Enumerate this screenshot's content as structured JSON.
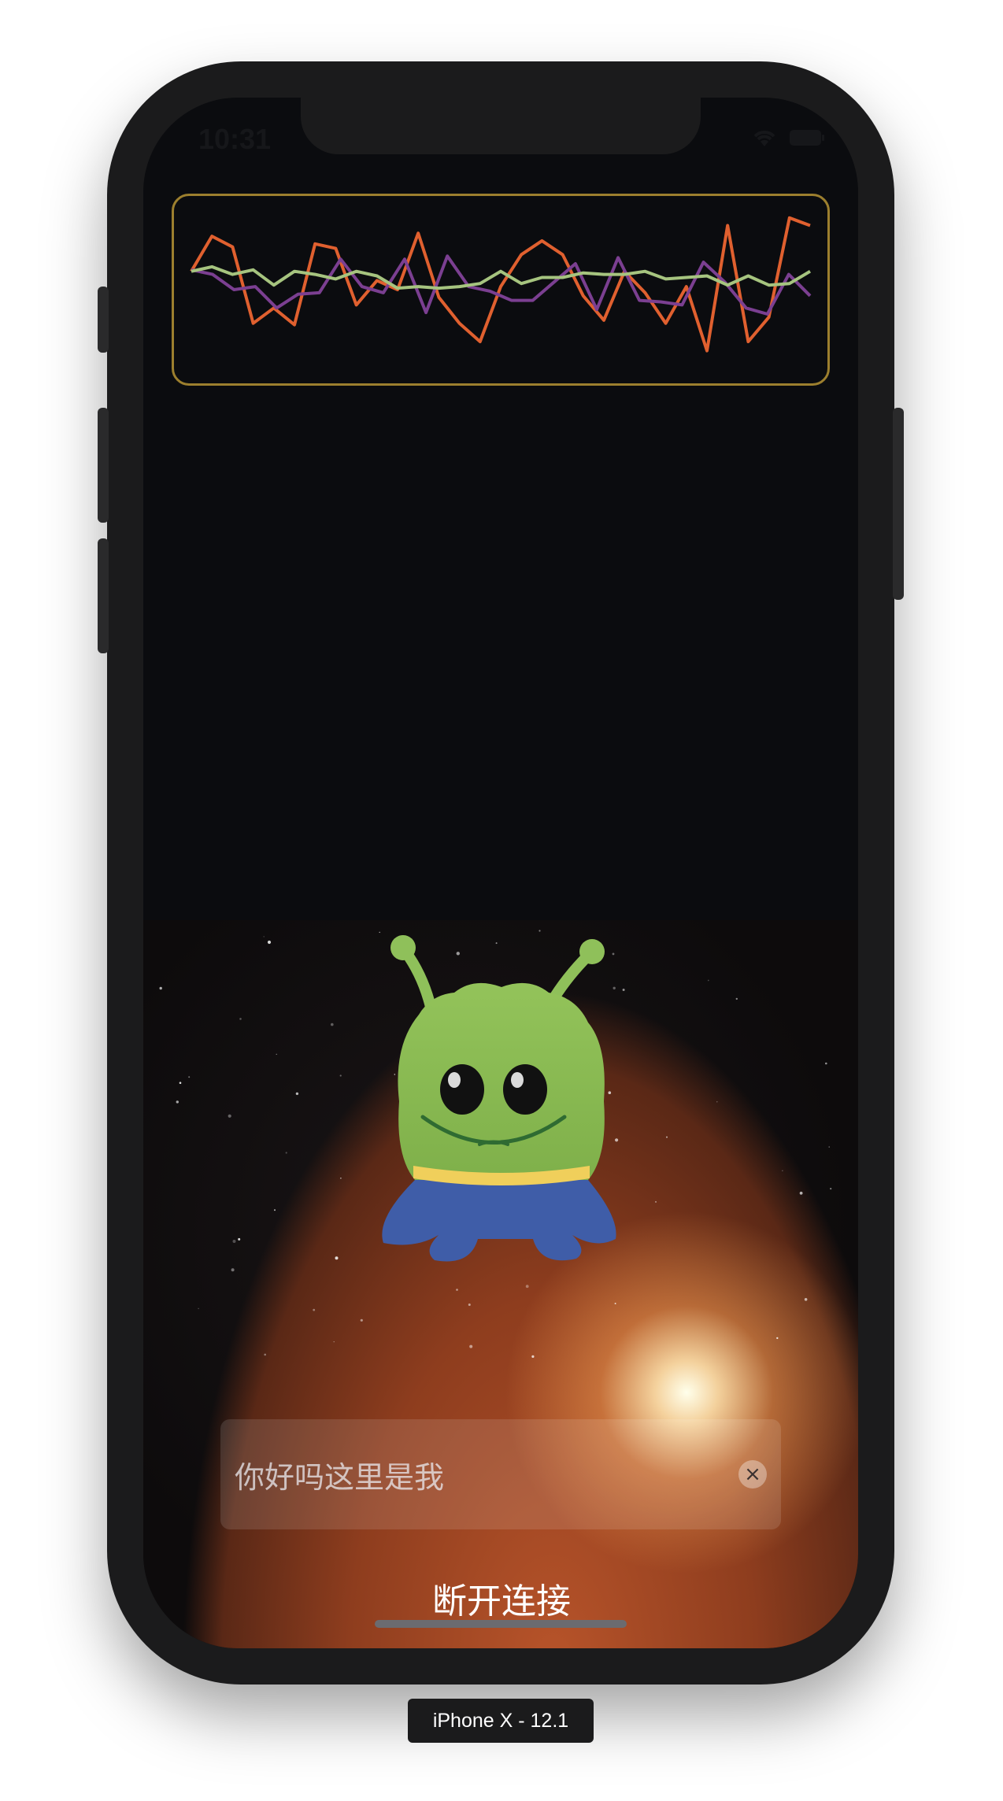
{
  "status_bar": {
    "time": "10:31",
    "icons": [
      "wifi-icon",
      "battery-icon"
    ]
  },
  "chart_data": {
    "type": "line",
    "series": [
      {
        "color": "#e0602f",
        "values": [
          0.62,
          0.85,
          0.78,
          0.28,
          0.38,
          0.27,
          0.8,
          0.77,
          0.4,
          0.56,
          0.5,
          0.87,
          0.45,
          0.28,
          0.16,
          0.52,
          0.73,
          0.82,
          0.73,
          0.46,
          0.3,
          0.62,
          0.48,
          0.28,
          0.52,
          0.1,
          0.92,
          0.16,
          0.32,
          0.97,
          0.92
        ]
      },
      {
        "color": "#7b3f91",
        "values": [
          0.63,
          0.6,
          0.5,
          0.52,
          0.38,
          0.47,
          0.48,
          0.7,
          0.52,
          0.48,
          0.7,
          0.35,
          0.72,
          0.52,
          0.49,
          0.43,
          0.43,
          0.55,
          0.67,
          0.37,
          0.71,
          0.43,
          0.42,
          0.4,
          0.68,
          0.55,
          0.38,
          0.34,
          0.6,
          0.46
        ]
      },
      {
        "color": "#a6c47f",
        "values": [
          0.62,
          0.65,
          0.6,
          0.63,
          0.53,
          0.62,
          0.6,
          0.57,
          0.62,
          0.59,
          0.51,
          0.52,
          0.51,
          0.52,
          0.54,
          0.62,
          0.54,
          0.58,
          0.58,
          0.61,
          0.6,
          0.6,
          0.62,
          0.57,
          0.58,
          0.59,
          0.53,
          0.59,
          0.53,
          0.54,
          0.62
        ]
      }
    ]
  },
  "mascot": {
    "name": "alien-mascot"
  },
  "input": {
    "value": "你好吗这里是我"
  },
  "actions": {
    "disconnect_label": "断开连接"
  },
  "device": {
    "label": "iPhone X - 12.1"
  }
}
